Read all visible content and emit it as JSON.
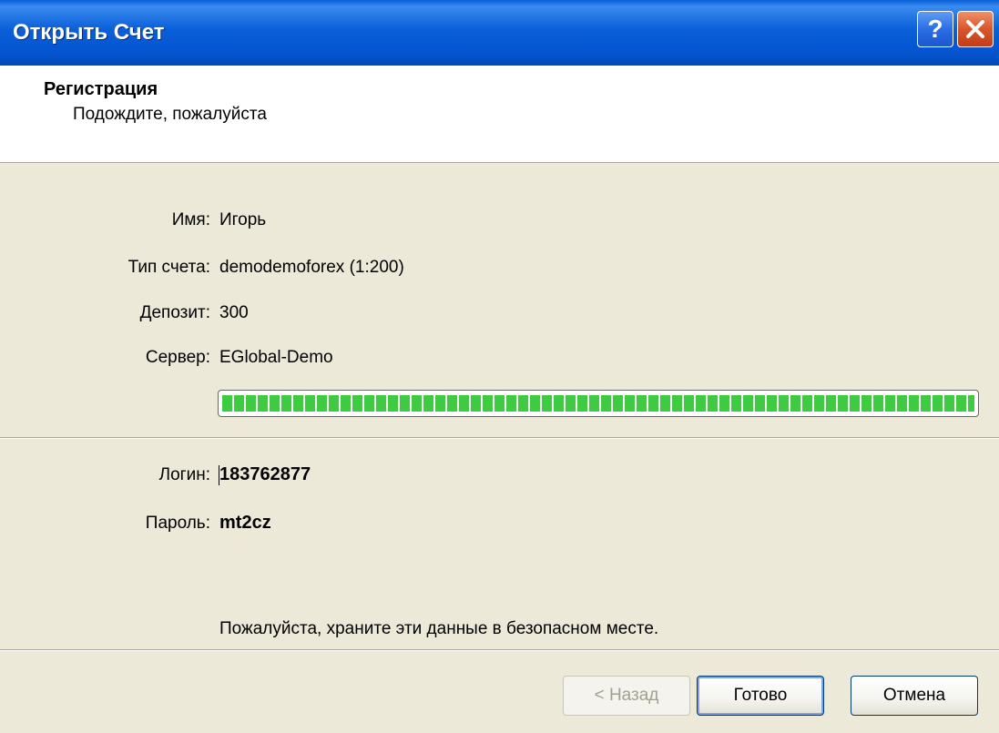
{
  "window": {
    "title": "Открыть Счет",
    "help_symbol": "?",
    "help_icon": "help-icon",
    "close_icon": "close-icon"
  },
  "header": {
    "title": "Регистрация",
    "subtitle": "Подождите, пожалуйста"
  },
  "fields": {
    "name_label": "Имя:",
    "name_value": "Игорь",
    "type_label": "Тип счета:",
    "type_value": "demodemoforex (1:200)",
    "deposit_label": "Депозит:",
    "deposit_value": "300",
    "server_label": "Сервер:",
    "server_value": "EGlobal-Demo"
  },
  "progress": {
    "percent": 100,
    "color": "#3fcb3f"
  },
  "credentials": {
    "login_label": "Логин:",
    "login_value": "183762877",
    "password_label": "Пароль:",
    "password_value": "mt2cz"
  },
  "note": "Пожалуйста, храните эти данные в безопасном месте.",
  "buttons": {
    "back": "< Назад",
    "done": "Готово",
    "cancel": "Отмена"
  },
  "colors": {
    "title_bar": "#0a5fd8",
    "dialog_bg": "#ece9d8",
    "close_button": "#d9552a"
  }
}
